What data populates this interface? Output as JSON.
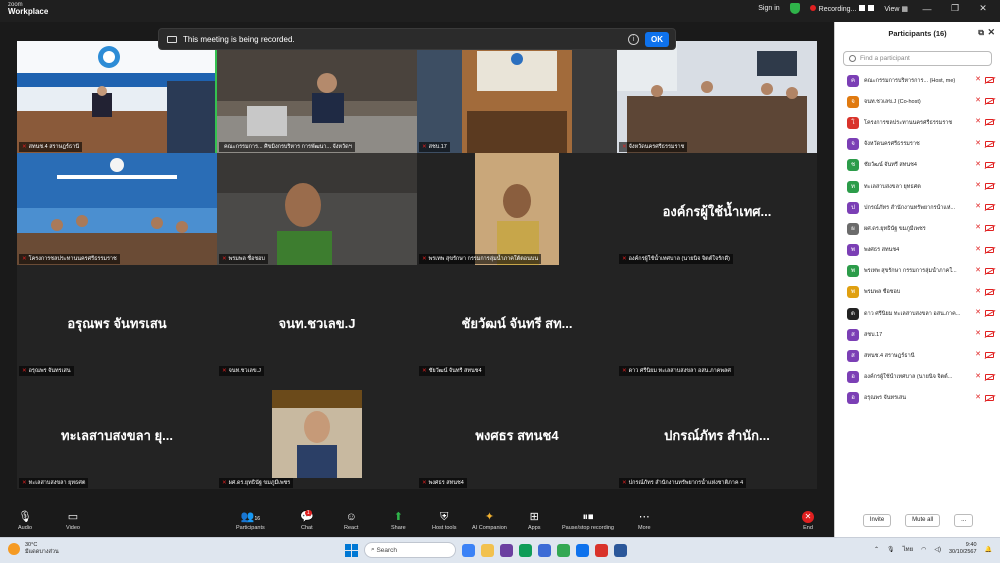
{
  "app": {
    "logo_line1": "zoom",
    "logo_line2": "Workplace"
  },
  "topbar": {
    "signin": "Sign in",
    "recording": "Recording...",
    "view": "View"
  },
  "banner": {
    "text": "This meeting is being recorded.",
    "ok": "OK"
  },
  "tiles": [
    {
      "name": "สทนช.4 สราษฎร์ธานี",
      "big": ""
    },
    {
      "name": "คณะกรรมการ... ศิขมิงกรบริหาร การพัฒนา... จังหวัดฯ",
      "big": ""
    },
    {
      "name": "สชบ.17",
      "big": ""
    },
    {
      "name": "จังหวัดนครศรีธรรมราช",
      "big": ""
    },
    {
      "name": "โครงการชลประทานนครศรีธรรมราช",
      "big": ""
    },
    {
      "name": "พรมพล ชื่อชอบ",
      "big": ""
    },
    {
      "name": "พรเทพ สุขรักษา กรรมการลุ่มน้ำภาคใต้ตอนบน",
      "big": ""
    },
    {
      "name": "องค์กรผู้ใช้น้ำเทศบาล (นายนิจ จิตต์ใจรักดี)",
      "big": "องค์กรผู้ใช้น้ำเทศ..."
    },
    {
      "name": "อรุณพร จันทรเสน",
      "big": "อรุณพร จันทรเสน"
    },
    {
      "name": "จนท.ชวเลข.J",
      "big": "จนท.ชวเลข.J"
    },
    {
      "name": "ชัยวัฒน์ จันทรี สทนช4",
      "big": "ชัยวัฒน์ จันทรี สท..."
    },
    {
      "name": "ดาว ศรีนิยม ทะเลสาบสงขลา อสน.ภาคพลศ",
      "big": ""
    },
    {
      "name": "ทะเลสาบสงขลา ยุทธศต",
      "big": "ทะเลสาบสงขลา ยุ..."
    },
    {
      "name": "ผศ.ดร.ยุทธินัฐ ขมภูมีเพชร",
      "big": ""
    },
    {
      "name": "พงศธร สทนช4",
      "big": "พงศธร สทนช4"
    },
    {
      "name": "ปกรณ์ภัทร สำนักงานทรัพยากรน้ำแห่งชาติภาค 4",
      "big": "ปกรณ์ภัทร สำนัก..."
    }
  ],
  "participants": {
    "title": "Participants (16)",
    "search_placeholder": "Find a participant",
    "items": [
      {
        "name": "คณะกรรมการบริหารการ... (Host, me)",
        "initial": "ค",
        "color": "#7b3fb5"
      },
      {
        "name": "จนท.ชวเลข.J (Co-host)",
        "initial": "จ",
        "color": "#e07a10"
      },
      {
        "name": "โครงการชลประทานนครศรีธรรมราช",
        "initial": "โ",
        "color": "#d9332b"
      },
      {
        "name": "จังหวัดนครศรีธรรมราช",
        "initial": "จ",
        "color": "#7b3fb5"
      },
      {
        "name": "ชัยวัฒน์ จันทรี สทนช4",
        "initial": "ช",
        "color": "#2c9c4a"
      },
      {
        "name": "ทะเลสาบสงขลา ยุทธศต",
        "initial": "ท",
        "color": "#2c9c4a"
      },
      {
        "name": "ปกรณ์ภัทร สำนักงานทรัพยากรน้ำแห่...",
        "initial": "ป",
        "color": "#7b3fb5"
      },
      {
        "name": "ผศ.ดร.ยุทธินัฐ ขมภูมีเพชร",
        "initial": "ผ",
        "color": "#6b6b6b"
      },
      {
        "name": "พงศธร สทนช4",
        "initial": "พ",
        "color": "#7b3fb5"
      },
      {
        "name": "พรเทพ สุขรักษา กรรมการลุ่มน้ำภาคใ...",
        "initial": "พ",
        "color": "#2c9c4a"
      },
      {
        "name": "พรมพล ชื่อชอบ",
        "initial": "พ",
        "color": "#e0a010"
      },
      {
        "name": "ดาว ศรีนิยม ทะเลสาบสงขลา อสน.ภาค...",
        "initial": "ด",
        "color": "#222222"
      },
      {
        "name": "สชบ.17",
        "initial": "ส",
        "color": "#7b3fb5"
      },
      {
        "name": "สทนช.4 สราษฎร์ธานี",
        "initial": "ส",
        "color": "#7b3fb5"
      },
      {
        "name": "องค์กรผู้ใช้น้ำเทศบาล (นายนิจ จิตต์...",
        "initial": "อ",
        "color": "#7b3fb5"
      },
      {
        "name": "อรุณพร จันทรเสน",
        "initial": "อ",
        "color": "#7b3fb5"
      }
    ],
    "invite": "Invite",
    "mute_all": "Mute all",
    "more": "..."
  },
  "toolbar": {
    "audio": "Audio",
    "video": "Video",
    "participants": "Participants",
    "participants_count": "16",
    "chat": "Chat",
    "chat_badge": "1",
    "react": "React",
    "share": "Share",
    "host_tools": "Host tools",
    "ai_companion": "AI Companion",
    "apps": "Apps",
    "pause_recording": "Pause/stop recording",
    "more": "More",
    "end": "End"
  },
  "taskbar": {
    "temp": "30°C",
    "weather_desc": "มีแดดบางส่วน",
    "search": "Search",
    "lang": "ไทย",
    "time": "9:40",
    "date": "30/10/2567"
  },
  "colors": {
    "accent": "#0e72ed",
    "record_red": "#e02020",
    "active_speaker": "#35c150"
  }
}
